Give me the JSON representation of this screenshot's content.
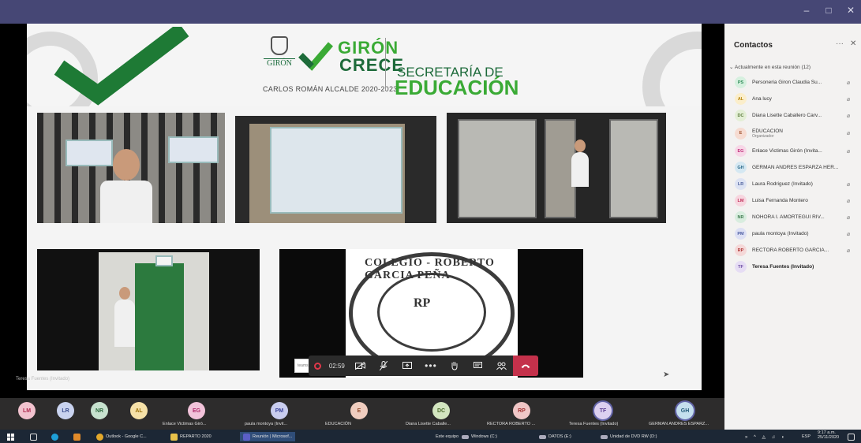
{
  "window": {
    "minimize": "–",
    "restore": "□",
    "close": "✕"
  },
  "slide": {
    "logo_city": "GIRÓN",
    "brand_top": "GIRÓN",
    "brand_bottom": "CRECE",
    "subtitle": "CARLOS ROMÁN ALCALDE 2020-2023",
    "secretaria_line1": "SECRETARÍA DE",
    "secretaria_line2": "EDUCACIÓN",
    "seal_text": "COLEGIO - ROBERTO GARCIA PEÑA",
    "seal_initials": "RP",
    "speaker_label": "Teresa Fuentes (Invitado)",
    "teams_hint": "teams.micros"
  },
  "call_bar": {
    "timer": "02:59"
  },
  "contacts": {
    "title": "Contactos",
    "more": "···",
    "close": "✕",
    "section": "Actualmente en esta reunión (12)",
    "participants": [
      {
        "initials": "PS",
        "name": "Personeria Giron Claudia Su...",
        "role": "",
        "color": "#2e8b57",
        "bg": "#d6f0df",
        "muted": true
      },
      {
        "initials": "AL",
        "name": "Ana lucy",
        "role": "",
        "color": "#b8860b",
        "bg": "#fbeecb",
        "muted": true
      },
      {
        "initials": "DC",
        "name": "Diana Lisette Caballero Carv...",
        "role": "",
        "color": "#5a7a3a",
        "bg": "#e4efd6",
        "muted": true
      },
      {
        "initials": "E",
        "name": "EDUCACIÓN",
        "role": "Organizador",
        "color": "#a0522d",
        "bg": "#f6dcd2",
        "muted": true
      },
      {
        "initials": "EG",
        "name": "Enlace Victimas Girón (Invita...",
        "role": "",
        "color": "#c0307a",
        "bg": "#f7d7e7",
        "muted": true
      },
      {
        "initials": "GH",
        "name": "GERMAN ANDRES ESPARZA HER...",
        "role": "",
        "color": "#2b6a8a",
        "bg": "#d5e8f2",
        "muted": false
      },
      {
        "initials": "LR",
        "name": "Laura Rodriguez (Invitado)",
        "role": "",
        "color": "#4a5d9a",
        "bg": "#dde3f3",
        "muted": true
      },
      {
        "initials": "LM",
        "name": "Luisa Fernanda Montero",
        "role": "",
        "color": "#c0305a",
        "bg": "#f7d6df",
        "muted": true
      },
      {
        "initials": "NR",
        "name": "NOHORA I. AMORTEGUI RIV...",
        "role": "",
        "color": "#3e7a4e",
        "bg": "#d9eddf",
        "muted": true
      },
      {
        "initials": "PM",
        "name": "paula montoya (Invitado)",
        "role": "",
        "color": "#4a5aa0",
        "bg": "#dde0f4",
        "muted": true
      },
      {
        "initials": "RP",
        "name": "RECTORA ROBERTO GARCIA...",
        "role": "",
        "color": "#b03a3a",
        "bg": "#f5d8d8",
        "muted": true
      },
      {
        "initials": "TF",
        "name": "Teresa Fuentes (Invitado)",
        "role": "",
        "color": "#6a4aa0",
        "bg": "#e6ddf4",
        "muted": false,
        "bold": true
      }
    ]
  },
  "strip": {
    "avatars": [
      {
        "initials": "LM",
        "label": "",
        "bg": "#f2c3cf",
        "color": "#b02a50"
      },
      {
        "initials": "LR",
        "label": "",
        "bg": "#c9d3ef",
        "color": "#3c4f8e"
      },
      {
        "initials": "NR",
        "label": "",
        "bg": "#c7e2cf",
        "color": "#2f6b40"
      },
      {
        "initials": "AL",
        "label": "",
        "bg": "#f6e1a8",
        "color": "#9a6f07"
      },
      {
        "initials": "EG",
        "label": "Enlace Victimas Giró...",
        "bg": "#f2c3da",
        "color": "#ad2a6a"
      },
      {
        "initials": "PM",
        "label": "paula montoya (Invit...",
        "bg": "#c9cdef",
        "color": "#3c469a"
      },
      {
        "initials": "E",
        "label": "EDUCACIÓN",
        "bg": "#f0cdbf",
        "color": "#924a2a"
      },
      {
        "initials": "DC",
        "label": "Diana Lisette Caballe...",
        "bg": "#d3e6c0",
        "color": "#4b6a2b"
      },
      {
        "initials": "RP",
        "label": "RECTORA ROBERTO ...",
        "bg": "#f0c6c6",
        "color": "#a03030"
      },
      {
        "initials": "TF",
        "label": "Teresa Fuentes (Invitado)",
        "bg": "#dcd0f0",
        "color": "#5a3d90"
      },
      {
        "initials": "GH",
        "label": "GERMAN ANDRES ESPARZ...",
        "bg": "#c4dfee",
        "color": "#235a78"
      }
    ]
  },
  "taskbar": {
    "outlook": "Outlook - Google C...",
    "reparto": "REPARTO 2020",
    "reunion": "Reunión | Microsof...",
    "este_equipo": "Este equipo",
    "windows_c": "Windows (C:)",
    "datos_e": "DATOS (E:)",
    "dvd": "Unidad de DVD RW (D:)",
    "lang": "ESP",
    "time": "9:17 a.m.",
    "date": "25/11/2020"
  }
}
